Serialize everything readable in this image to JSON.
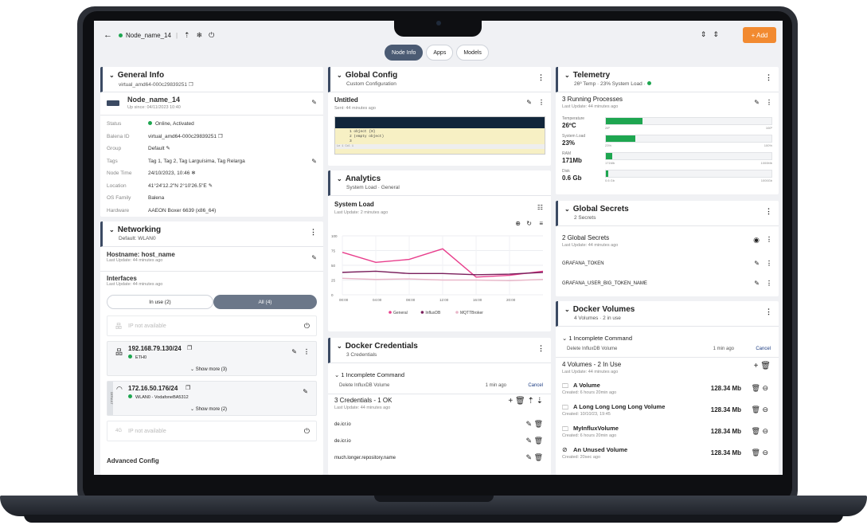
{
  "header": {
    "node_name": "Node_name_14",
    "add_label": "+ Add"
  },
  "tabs": [
    {
      "label": "Node Info"
    },
    {
      "label": "Apps"
    },
    {
      "label": "Models"
    }
  ],
  "general_info": {
    "title": "General Info",
    "subtitle": "virtual_amd64-000c29839251",
    "node_name": "Node_name_14",
    "up_since": "Up since: 04/11/2023 10:40",
    "fields": [
      {
        "label": "Status",
        "value": "Online, Activated"
      },
      {
        "label": "Balena ID",
        "value": "virtual_amd64-000c29839251"
      },
      {
        "label": "Group",
        "value": "Default"
      },
      {
        "label": "Tags",
        "value": "Tag 1, Tag 2, Tag Larguísima, Tag Relarga"
      },
      {
        "label": "Node Time",
        "value": "24/10/2023, 10:46"
      },
      {
        "label": "Location",
        "value": "41°24'12.2\"N 2°10'26.5\"E"
      },
      {
        "label": "OS Family",
        "value": "Balena"
      },
      {
        "label": "Hardware",
        "value": "AAEON Boxer 6639 (x86_64)"
      }
    ]
  },
  "networking": {
    "title": "Networking",
    "subtitle": "Default: WLAN0",
    "hostname": "Hostname: host_name",
    "hostname_update": "Last Update: 44 minutes ago",
    "interfaces_title": "Interfaces",
    "interfaces_update": "Last Update: 44 minutes ago",
    "in_use": "In use (2)",
    "all": "All (4)",
    "ip_not_available": "IP not available",
    "eth_ip": "192.168.79.130/24",
    "eth_name": "ETH0",
    "show_more_eth": "Show more (3)",
    "wlan_ip": "172.16.50.176/24",
    "wlan_name": "WLAN0 - VodafoneBA5312",
    "show_more_wlan": "Show more (2)",
    "default_tag": "DEFAULT",
    "fourg_label": "4G",
    "ip_not_available_2": "IP not available",
    "advanced": "Advanced Config"
  },
  "global_config": {
    "title": "Global Config",
    "subtitle": "Custom Configuration",
    "entry_title": "Untitled",
    "entry_sent": "Sent: 44 minutes ago",
    "code_lines": [
      "1      object {0}",
      "2        (empty object)",
      "3"
    ],
    "code_footer": "Ln 1  Col 1"
  },
  "analytics": {
    "title": "Analytics",
    "subtitle": "System Load · General",
    "chart_title": "System Load",
    "chart_update": "Last Update: 2 minutes ago"
  },
  "chart_data": {
    "type": "line",
    "x": [
      "00:00",
      "04:00",
      "08:00",
      "12:00",
      "16:00",
      "20:00"
    ],
    "series": [
      {
        "name": "General",
        "color": "#e83e8c",
        "values": [
          72,
          55,
          60,
          78,
          30,
          33,
          40
        ]
      },
      {
        "name": "InfluxDB",
        "color": "#7a1f5c",
        "values": [
          38,
          40,
          36,
          36,
          34,
          35,
          38
        ]
      },
      {
        "name": "MQTTBroker",
        "color": "#e9b7c9",
        "values": [
          28,
          26,
          27,
          25,
          25,
          24,
          26
        ]
      }
    ],
    "yticks": [
      0,
      25,
      50,
      75,
      100
    ],
    "ylim": [
      0,
      100
    ]
  },
  "docker_credentials": {
    "title": "Docker Credentials",
    "subtitle": "3 Credentials",
    "incomplete": "1 Incomplete Command",
    "cmd": "Delete InfluxDB Volume",
    "cmd_time": "1 min ago",
    "cancel": "Cancel",
    "summary": "3 Credentials - 1 OK",
    "summary_update": "Last Update: 44 minutes ago",
    "items": [
      {
        "name": "de.icr.io"
      },
      {
        "name": "de.icr.io"
      },
      {
        "name": "much.longer.repository.name"
      }
    ]
  },
  "telemetry": {
    "title": "Telemetry",
    "subtitle": "26º Temp · 23% System Load ·",
    "processes": "3 Running Processes",
    "processes_update": "Last Update: 44 minutes ago",
    "metrics": [
      {
        "label": "Temperature",
        "value": "26ºC",
        "min": "26º",
        "max": "100º",
        "fraction": 0.22
      },
      {
        "label": "System Load",
        "value": "23%",
        "min": "23%",
        "max": "100%",
        "fraction": 0.18
      },
      {
        "label": "RAM",
        "value": "171Mb",
        "min": "171Mb",
        "max": "1000Mb",
        "fraction": 0.04
      },
      {
        "label": "Disk",
        "value": "0.6 Gb",
        "min": "0.6 Gb",
        "max": "1000Gb",
        "fraction": 0.01
      }
    ]
  },
  "global_secrets": {
    "title": "Global Secrets",
    "subtitle": "2 Secrets",
    "summary": "2 Global Secrets",
    "summary_update": "Last Update: 44 minutes ago",
    "items": [
      {
        "name": "GRAFANA_TOKEN"
      },
      {
        "name": "GRAFANA_USER_BIG_TOKEN_NAME"
      }
    ]
  },
  "docker_volumes": {
    "title": "Docker Volumes",
    "subtitle": "4 Volumes · 2 in use",
    "incomplete": "1 Incomplete Command",
    "cmd": "Delete InfluxDB Volume",
    "cmd_time": "1 min ago",
    "cancel": "Cancel",
    "summary": "4 Volumes - 2 In Use",
    "summary_update": "Last Update: 44 minutes ago",
    "volumes": [
      {
        "name": "A Volume",
        "created": "Created: 6 hours 20min ago",
        "size": "128.34 Mb"
      },
      {
        "name": "A Long Long Long Long Volume",
        "created": "Created: 10/10/23, 19:45",
        "size": "128.34 Mb"
      },
      {
        "name": "MyInfluxVolume",
        "created": "Created: 6 hours 20min ago",
        "size": "128.34 Mb"
      },
      {
        "name": "An Unused Volume",
        "created": "Created: 20sec ago",
        "size": "128.34 Mb"
      }
    ]
  }
}
